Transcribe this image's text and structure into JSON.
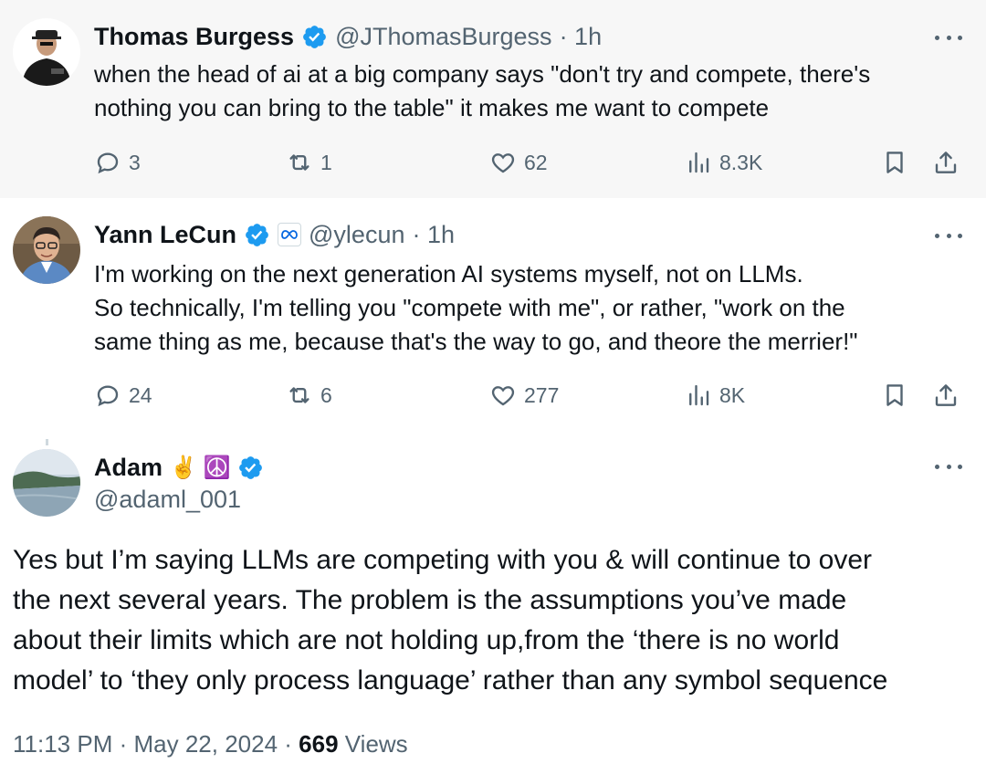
{
  "tweets": [
    {
      "name": "Thomas Burgess",
      "handle": "@JThomasBurgess",
      "time": "· 1h",
      "lines": [
        "when the head of ai at a big company says \"don't try and compete, there's",
        "nothing you can bring to the table\" it makes me want to compete"
      ],
      "replies": "3",
      "retweets": "1",
      "likes": "62",
      "views": "8.3K"
    },
    {
      "name": "Yann LeCun",
      "handle": "@ylecun",
      "time": "· 1h",
      "lines": [
        "I'm working on the next generation AI systems myself, not on LLMs.",
        "So technically, I'm telling you \"compete with me\", or rather, \"work on the",
        "same thing as me, because that's the way to go, and theore the merrier!\""
      ],
      "replies": "24",
      "retweets": "6",
      "likes": "277",
      "views": "8K"
    }
  ],
  "main_tweet": {
    "name": "Adam",
    "name_emojis": "✌️ ☮️",
    "handle": "@adaml_001",
    "lines": [
      "Yes but I’m saying LLMs are competing with you & will continue to over",
      "the next several years. The problem is the assumptions you’ve made",
      "about their limits which are not holding up,from the ‘there is no world",
      "model’ to ‘they only process language’ rather than any symbol sequence"
    ],
    "time": "11:13 PM",
    "date": "May 22, 2024",
    "views_count": "669",
    "views_label": "Views"
  },
  "colors": {
    "verified": "#1d9bf0",
    "muted": "#536471",
    "text": "#0f1419"
  }
}
